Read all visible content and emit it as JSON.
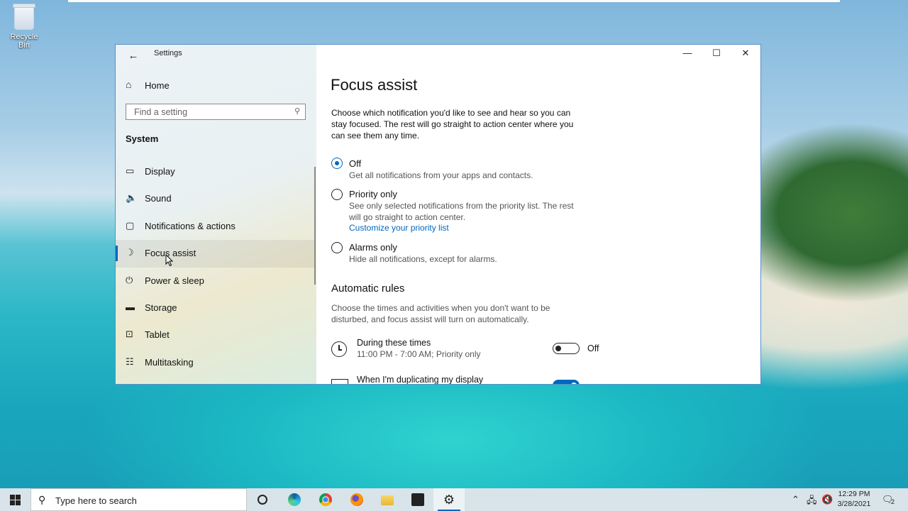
{
  "desktop": {
    "recycle_bin_label": "Recycle Bin"
  },
  "window": {
    "title": "Settings",
    "controls": {
      "minimize": "—",
      "maximize": "☐",
      "close": "✕"
    }
  },
  "sidebar": {
    "home_label": "Home",
    "search_placeholder": "Find a setting",
    "section_title": "System",
    "items": [
      {
        "label": "Display",
        "icon": "monitor-icon"
      },
      {
        "label": "Sound",
        "icon": "speaker-icon"
      },
      {
        "label": "Notifications & actions",
        "icon": "notification-icon"
      },
      {
        "label": "Focus assist",
        "icon": "moon-icon",
        "active": true
      },
      {
        "label": "Power & sleep",
        "icon": "power-icon"
      },
      {
        "label": "Storage",
        "icon": "storage-icon"
      },
      {
        "label": "Tablet",
        "icon": "tablet-icon"
      },
      {
        "label": "Multitasking",
        "icon": "multitasking-icon"
      }
    ]
  },
  "main": {
    "title": "Focus assist",
    "intro": [
      "Choose which notification you'd like to see and hear so you can",
      "stay focused. The rest will go straight to action center where you",
      "can see them any time."
    ],
    "options": [
      {
        "label": "Off",
        "desc": [
          "Get all notifications from your apps and contacts."
        ],
        "selected": true
      },
      {
        "label": "Priority only",
        "desc": [
          "See only selected notifications from the priority list. The rest",
          "will go straight to action center."
        ],
        "link": "Customize your priority list",
        "selected": false
      },
      {
        "label": "Alarms only",
        "desc": [
          "Hide all notifications, except for alarms."
        ],
        "selected": false
      }
    ],
    "automatic": {
      "title": "Automatic rules",
      "desc": [
        "Choose the times and activities when you don't want to be",
        "disturbed, and focus assist will turn on automatically."
      ],
      "rules": [
        {
          "title": "During these times",
          "subtitle": "11:00 PM - 7:00 AM; Priority only",
          "state": "Off",
          "on": false
        },
        {
          "title": "When I'm duplicating my display",
          "subtitle": "",
          "state": "On",
          "on": true
        }
      ]
    }
  },
  "taskbar": {
    "search_placeholder": "Type here to search",
    "apps": [
      "task-view",
      "edge",
      "chrome",
      "firefox",
      "file-explorer",
      "store",
      "settings"
    ],
    "time": "12:29 PM",
    "date": "3/28/2021",
    "notifications_count": "2",
    "accent": "#0067c0"
  }
}
